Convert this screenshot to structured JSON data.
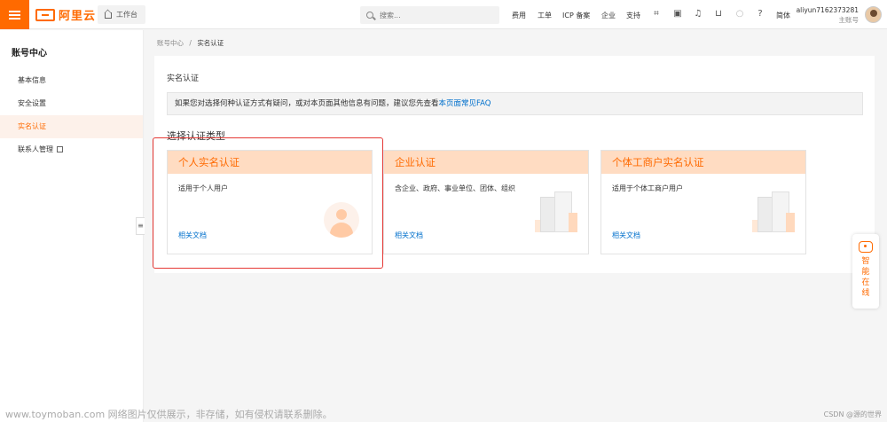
{
  "topbar": {
    "logo": "阿里云",
    "workbench": "工作台",
    "search_placeholder": "搜索...",
    "links": [
      "费用",
      "工单",
      "ICP 备案",
      "企业",
      "支持"
    ],
    "lang": "简体",
    "user": {
      "name": "aliyun7162373281",
      "role": "主账号"
    }
  },
  "sidebar": {
    "title": "账号中心",
    "items": [
      {
        "label": "基本信息"
      },
      {
        "label": "安全设置"
      },
      {
        "label": "实名认证"
      },
      {
        "label": "联系人管理"
      }
    ]
  },
  "breadcrumb": {
    "parent": "账号中心",
    "sep": "/",
    "current": "实名认证"
  },
  "main": {
    "title": "实名认证",
    "notice": {
      "text": "如果您对选择何种认证方式有疑问，或对本页面其他信息有问题，建议您先查看",
      "link": "本页面常见FAQ"
    },
    "section_title": "选择认证类型",
    "cards": [
      {
        "title": "个人实名认证",
        "desc": "适用于个人用户",
        "link": "相关文档",
        "illustration": "person-icon"
      },
      {
        "title": "企业认证",
        "desc": "含企业、政府、事业单位、团体、组织",
        "link": "相关文档",
        "illustration": "building-icon"
      },
      {
        "title": "个体工商户实名认证",
        "desc": "适用于个体工商户用户",
        "link": "相关文档",
        "illustration": "building-icon"
      }
    ]
  },
  "assistant": {
    "label": "智能在线"
  },
  "footer": {
    "watermark": "www.toymoban.com 网络图片仅供展示，非存储，如有侵权请联系删除。",
    "credit": "CSDN @源的世界"
  },
  "colors": {
    "accent": "#ff6a00",
    "link": "#0070cc",
    "highlight": "#e53935"
  }
}
